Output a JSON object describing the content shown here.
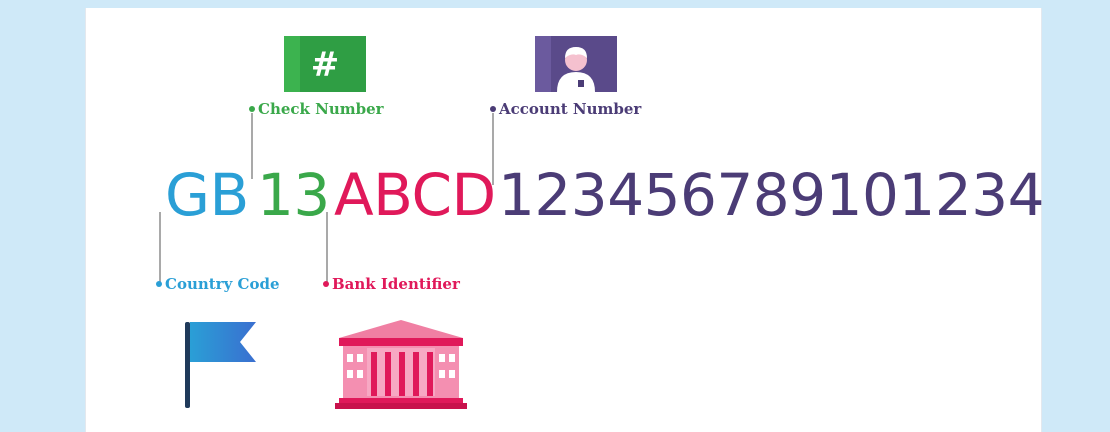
{
  "colors": {
    "country": "#2a9fd6",
    "check": "#3aa84a",
    "bank": "#e0195a",
    "account": "#4b3c76",
    "background": "#cfe9f8"
  },
  "iban": {
    "country_code": "GB",
    "check_digits": "13",
    "bank_identifier": "ABCD",
    "account_number": "123456789101234"
  },
  "labels": {
    "check_number": "Check Number",
    "account_number": "Account Number",
    "country_code": "Country Code",
    "bank_identifier": "Bank Identifier"
  },
  "icons": {
    "check_tag_symbol": "#",
    "check_tag": "hash-ticket-icon",
    "account_tag": "person-ticket-icon",
    "country": "flag-icon",
    "bank": "bank-building-icon"
  }
}
